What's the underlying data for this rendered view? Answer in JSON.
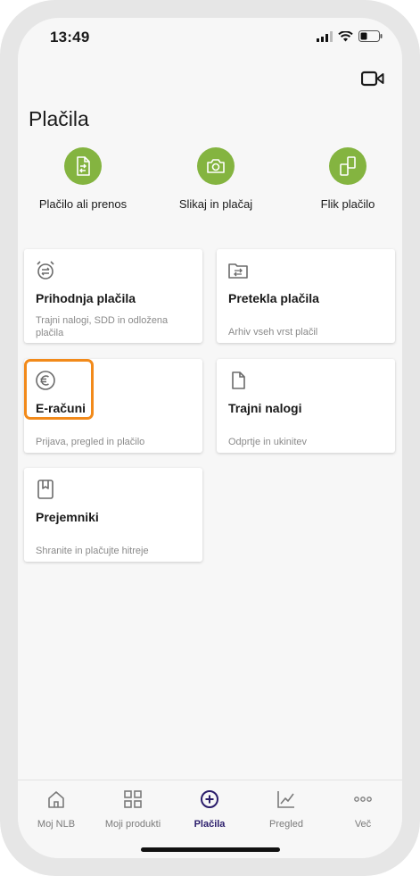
{
  "status_bar": {
    "time": "13:49"
  },
  "header": {
    "title": "Plačila"
  },
  "quick_actions": [
    {
      "label": "Plačilo ali prenos",
      "icon": "transfer-document-icon"
    },
    {
      "label": "Slikaj in plačaj",
      "icon": "camera-icon"
    },
    {
      "label": "Flik plačilo",
      "icon": "flik-icon"
    }
  ],
  "cards": {
    "future_payments": {
      "title": "Prihodnja plačila",
      "desc": "Trajni nalogi, SDD in odložena plačila",
      "icon": "alarm-clock-icon"
    },
    "past_payments": {
      "title": "Pretekla plačila",
      "desc": "Arhiv vseh vrst plačil",
      "icon": "folder-transfer-icon"
    },
    "e_invoices": {
      "title": "E-računi",
      "desc": "Prijava, pregled in plačilo",
      "icon": "euro-icon"
    },
    "standing_orders": {
      "title": "Trajni nalogi",
      "desc": "Odprtje in ukinitev",
      "icon": "document-icon"
    },
    "recipients": {
      "title": "Prejemniki",
      "desc": "Shranite in plačujte hitreje",
      "icon": "bookmark-book-icon"
    }
  },
  "bottom_nav": [
    {
      "label": "Moj NLB",
      "icon": "home-icon",
      "active": false
    },
    {
      "label": "Moji produkti",
      "icon": "grid-icon",
      "active": false
    },
    {
      "label": "Plačila",
      "icon": "plus-circle-icon",
      "active": true
    },
    {
      "label": "Pregled",
      "icon": "chart-icon",
      "active": false
    },
    {
      "label": "Več",
      "icon": "more-dots-icon",
      "active": false
    }
  ],
  "colors": {
    "accent_green": "#84b440",
    "active_nav": "#2b1d6b",
    "highlight": "#f28a1a"
  }
}
